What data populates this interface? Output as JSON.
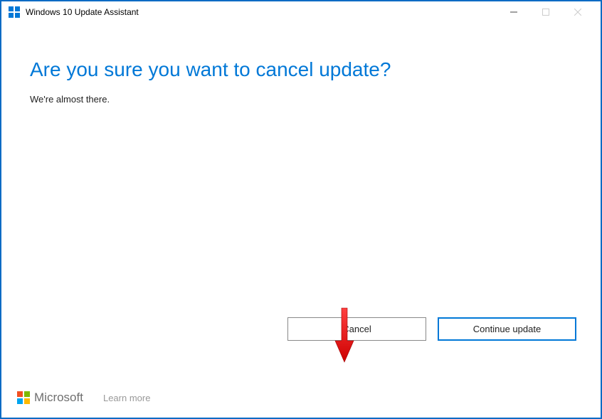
{
  "window": {
    "title": "Windows 10 Update Assistant"
  },
  "main": {
    "heading": "Are you sure you want to cancel update?",
    "subtext": "We're almost there."
  },
  "buttons": {
    "cancel": "Cancel",
    "continue": "Continue update"
  },
  "footer": {
    "brand": "Microsoft",
    "learn_more": "Learn more"
  }
}
